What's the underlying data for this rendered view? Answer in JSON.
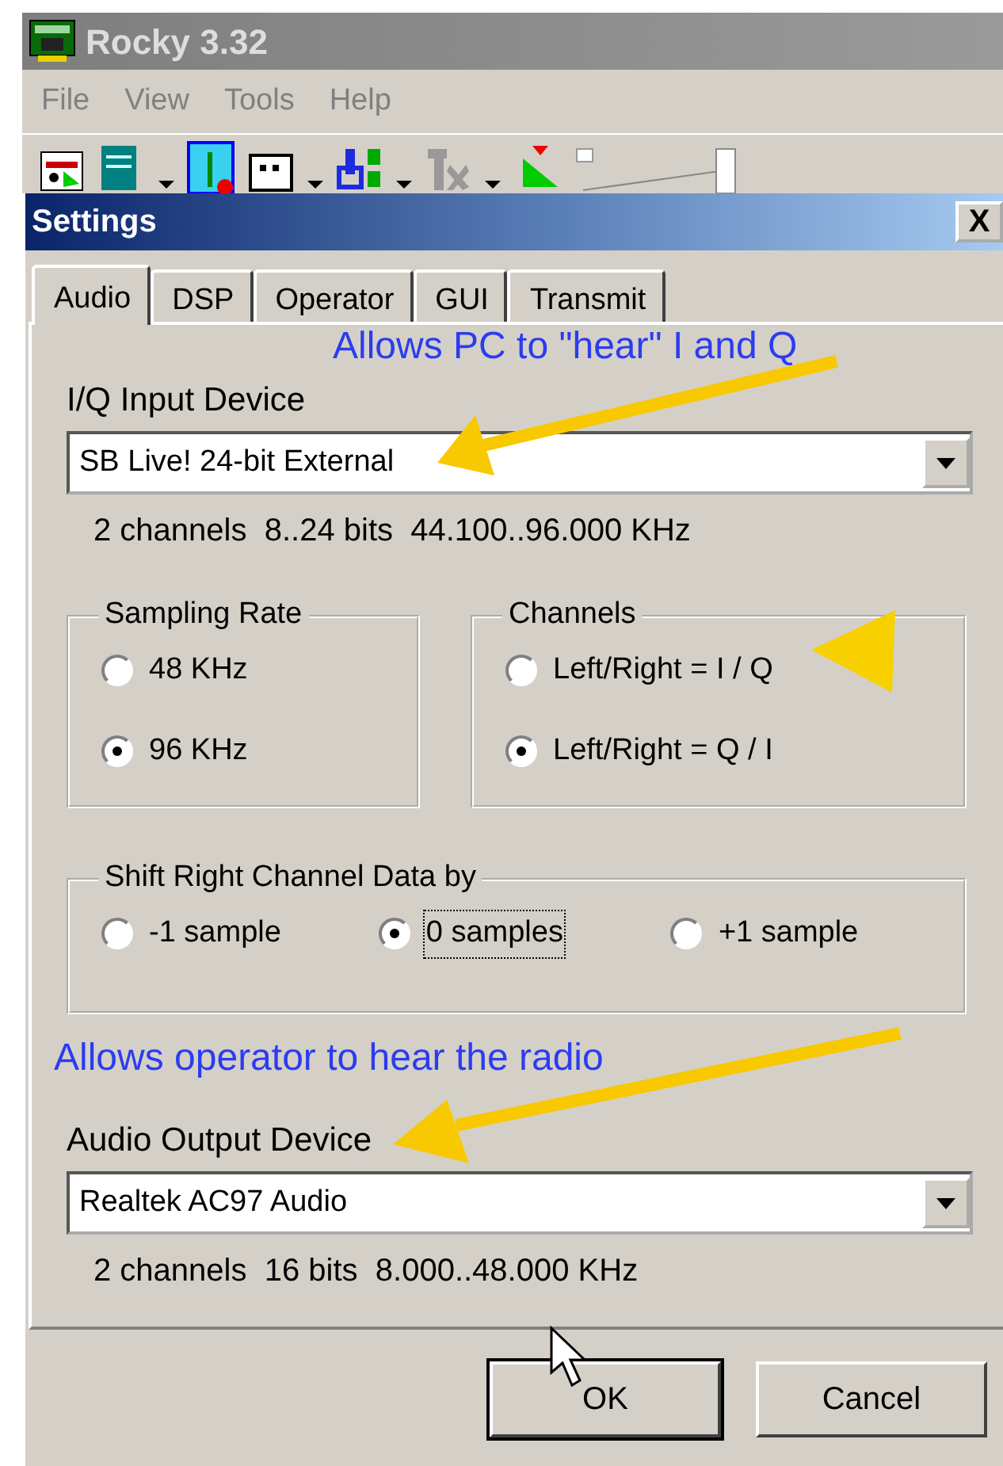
{
  "app": {
    "title": "Rocky 3.32",
    "menu": [
      "File",
      "View",
      "Tools",
      "Help"
    ]
  },
  "dialog": {
    "title": "Settings",
    "close": "X",
    "tabs": [
      {
        "label": "Audio",
        "selected": true
      },
      {
        "label": "DSP",
        "selected": false
      },
      {
        "label": "Operator",
        "selected": false
      },
      {
        "label": "GUI",
        "selected": false
      },
      {
        "label": "Transmit",
        "selected": false
      }
    ],
    "annotations": [
      "Allows PC to \"hear\" I and Q",
      "Allows operator to hear the radio"
    ],
    "input_device": {
      "label": "I/Q Input Device",
      "value": "SB Live! 24-bit External",
      "info": "2 channels  8..24 bits  44.100..96.000 KHz"
    },
    "sampling_rate": {
      "title": "Sampling Rate",
      "options": [
        {
          "label": "48 KHz",
          "selected": false,
          "focused": false
        },
        {
          "label": "96 KHz",
          "selected": true,
          "focused": false
        }
      ]
    },
    "channels": {
      "title": "Channels",
      "options": [
        {
          "label": "Left/Right = I / Q",
          "selected": false,
          "focused": false
        },
        {
          "label": "Left/Right = Q / I",
          "selected": true,
          "focused": false
        }
      ]
    },
    "shift": {
      "title": "Shift Right Channel Data by",
      "options": [
        {
          "label": "-1 sample",
          "selected": false,
          "focused": false
        },
        {
          "label": "0 samples",
          "selected": true,
          "focused": true
        },
        {
          "label": "+1 sample",
          "selected": false,
          "focused": false
        }
      ]
    },
    "output_device": {
      "label": "Audio Output Device",
      "value": "Realtek AC97 Audio",
      "info": "2 channels  16 bits  8.000..48.000 KHz"
    },
    "buttons": [
      {
        "label": "OK",
        "default": true
      },
      {
        "label": "Cancel",
        "default": false
      }
    ]
  }
}
